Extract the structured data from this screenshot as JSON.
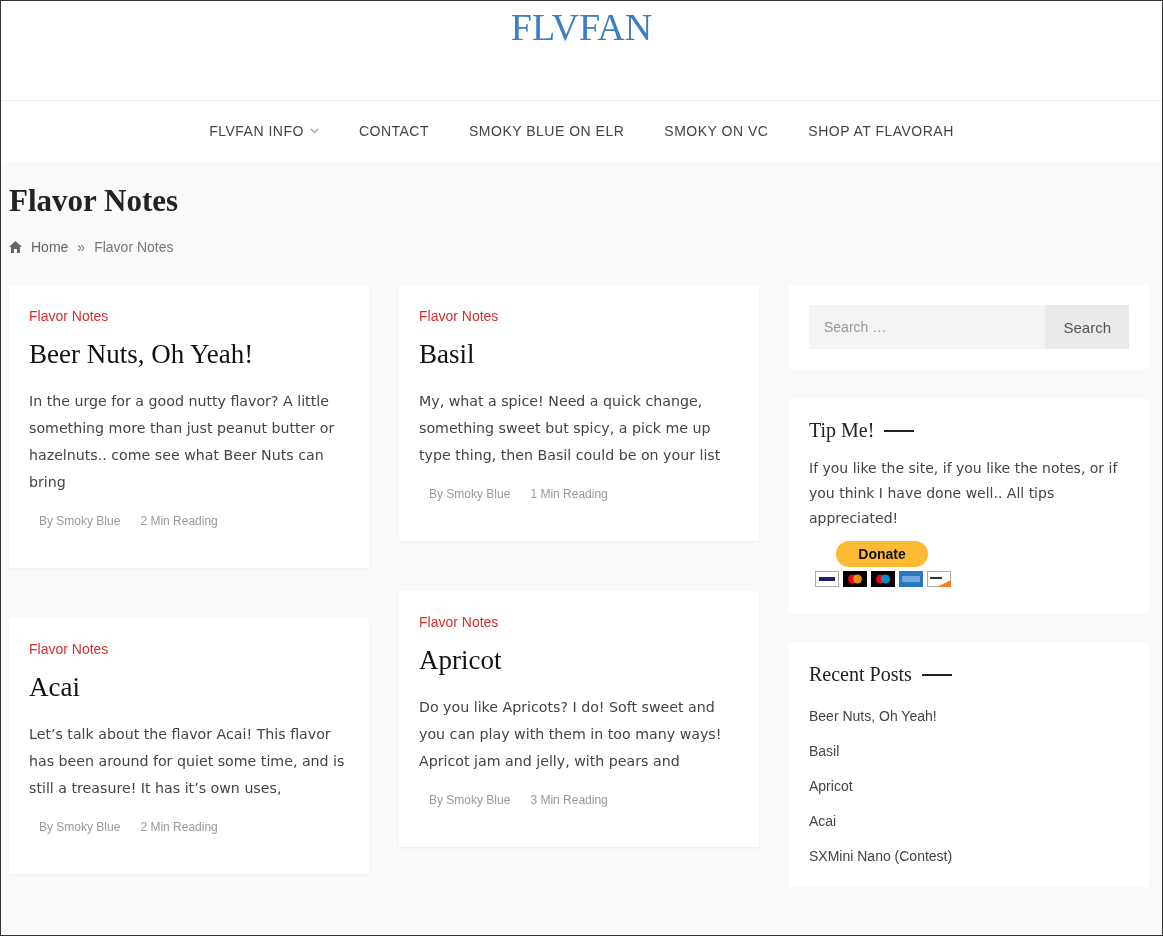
{
  "site_title": "FLVFAN",
  "nav": [
    {
      "label": "FLVFAN INFO",
      "has_submenu": true
    },
    {
      "label": "CONTACT",
      "has_submenu": false
    },
    {
      "label": "SMOKY BLUE ON ELR",
      "has_submenu": false
    },
    {
      "label": "SMOKY ON VC",
      "has_submenu": false
    },
    {
      "label": "SHOP AT FLAVORAH",
      "has_submenu": false
    }
  ],
  "page_title": "Flavor Notes",
  "breadcrumb": [
    "Home",
    "»",
    "Flavor Notes"
  ],
  "posts": [
    {
      "category": "Flavor Notes",
      "title": "Beer Nuts, Oh Yeah!",
      "excerpt": "In the urge for a good nutty flavor? A little something more than just peanut butter or hazelnuts.. come see what Beer Nuts can bring",
      "author": "By Smoky Blue",
      "reading": "2 Min Reading"
    },
    {
      "category": "Flavor Notes",
      "title": "Acai",
      "excerpt": "Let’s talk about the flavor Acai! This flavor has been around for quiet some time, and is still a treasure! It has it’s own uses,",
      "author": "By Smoky Blue",
      "reading": "2 Min Reading"
    },
    {
      "category": "Flavor Notes",
      "title": "Basil",
      "excerpt": "My, what a spice! Need a quick change, something sweet but spicy, a pick me up type thing, then Basil could be on your list",
      "author": "By Smoky Blue",
      "reading": "1 Min Reading"
    },
    {
      "category": "Flavor Notes",
      "title": "Apricot",
      "excerpt": "Do you like Apricots? I do! Soft sweet and you can play with them in too many ways! Apricot jam and jelly, with pears and",
      "author": "By Smoky Blue",
      "reading": "3 Min Reading"
    }
  ],
  "search": {
    "placeholder": "Search …",
    "button": "Search"
  },
  "tip": {
    "title": "Tip Me!",
    "text": "If you like the site, if you like the notes, or if you think I have done well.. All tips appreciated!",
    "button": "Donate"
  },
  "recent": {
    "title": "Recent Posts",
    "items": [
      "Beer Nuts, Oh Yeah!",
      "Basil",
      "Apricot",
      "Acai",
      "SXMini Nano (Contest)"
    ]
  }
}
